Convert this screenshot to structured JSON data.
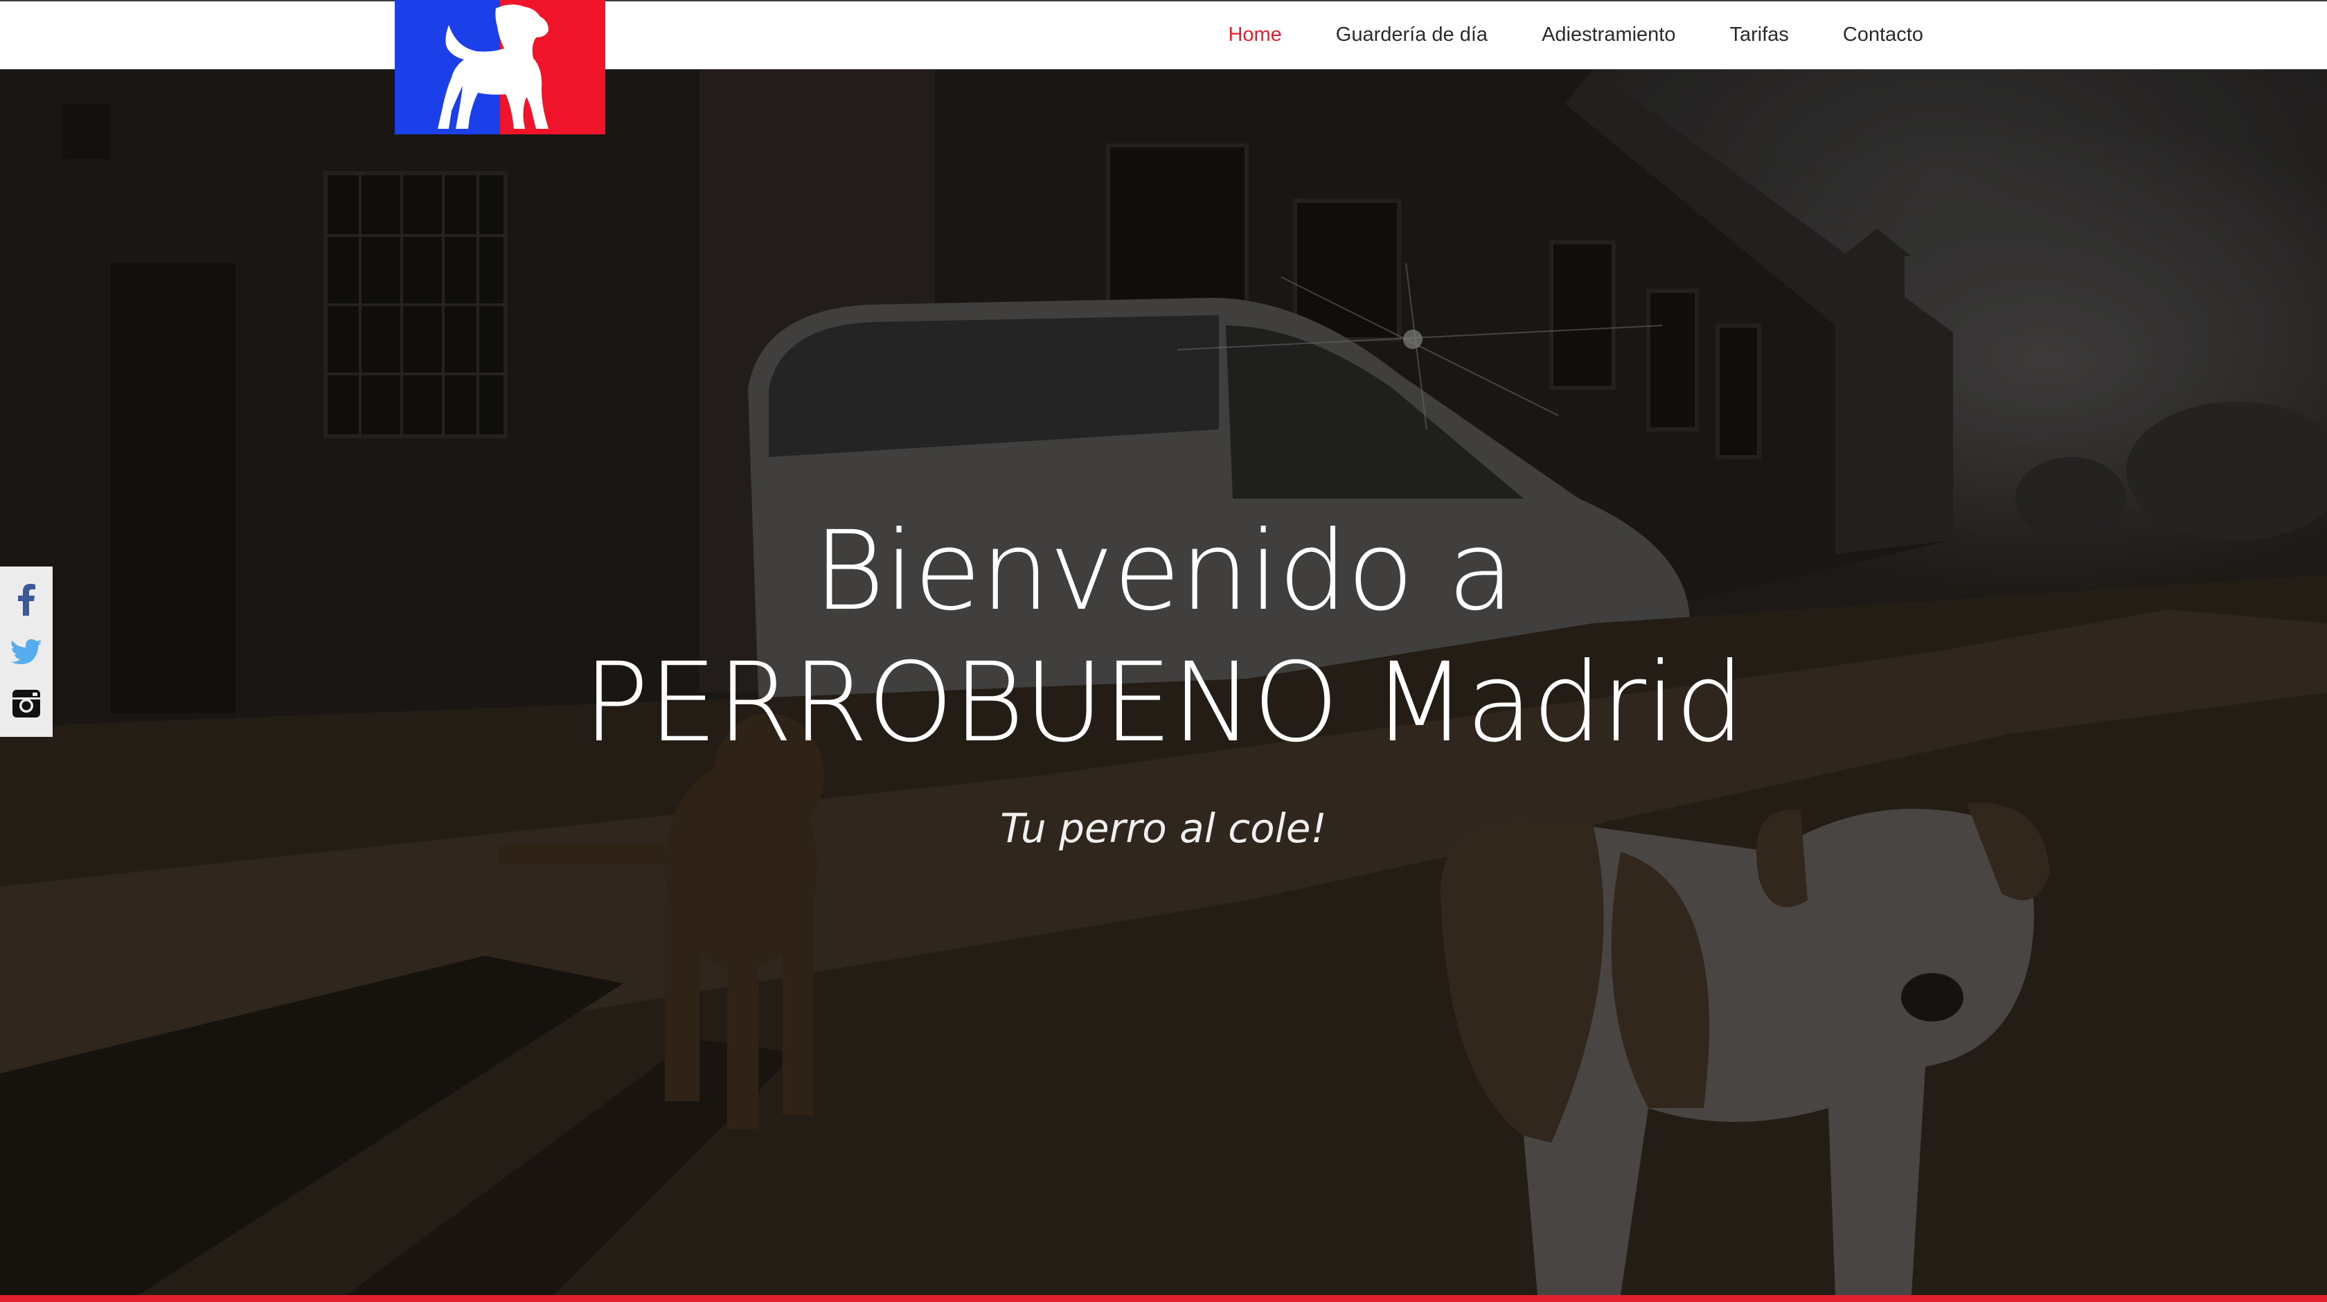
{
  "nav": {
    "items": [
      {
        "label": "Home",
        "active": true
      },
      {
        "label": "Guardería de día",
        "active": false
      },
      {
        "label": "Adiestramiento",
        "active": false
      },
      {
        "label": "Tarifas",
        "active": false
      },
      {
        "label": "Contacto",
        "active": false
      }
    ],
    "active_color": "#e3202e",
    "text_color": "#2b2b2b"
  },
  "logo": {
    "icon": "dog-silhouette-icon",
    "colors": {
      "left": "#1b3fe8",
      "right": "#f0142a",
      "figure": "#ffffff"
    }
  },
  "social": {
    "items": [
      {
        "icon": "facebook-icon",
        "color": "#3b5998"
      },
      {
        "icon": "twitter-icon",
        "color": "#55acee"
      },
      {
        "icon": "instagram-icon",
        "color": "#111111"
      }
    ]
  },
  "hero": {
    "title_line1": "Bienvenido a",
    "title_line2": "PERROBUENO Madrid",
    "subtitle": "Tu perro al cole!"
  },
  "accent_color": "#e3202e"
}
